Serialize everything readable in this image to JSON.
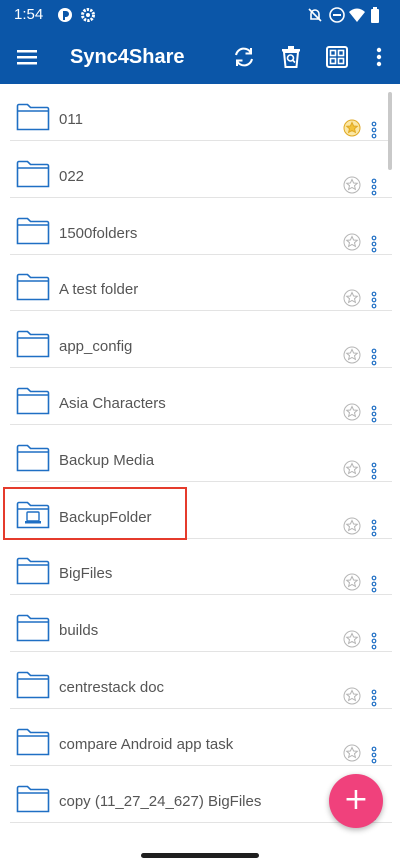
{
  "status_bar": {
    "time": "1:54",
    "left_icons": [
      "app-notification-icon",
      "settings-gear-icon"
    ],
    "right_icons": [
      "notifications-off-icon",
      "do-not-disturb-icon",
      "wifi-icon",
      "battery-icon"
    ]
  },
  "app_bar": {
    "title": "Sync4Share",
    "icons": [
      "menu-icon",
      "sync-icon",
      "recycle-bin-icon",
      "grid-view-icon",
      "overflow-menu-icon"
    ]
  },
  "folders": [
    {
      "name": "011",
      "favorite": true
    },
    {
      "name": "022",
      "favorite": false
    },
    {
      "name": "1500folders",
      "favorite": false
    },
    {
      "name": "A test folder",
      "favorite": false
    },
    {
      "name": "app_config",
      "favorite": false
    },
    {
      "name": "Asia Characters",
      "favorite": false
    },
    {
      "name": "Backup Media",
      "favorite": false
    },
    {
      "name": "BackupFolder",
      "favorite": false,
      "special_icon": "backup-folder-icon"
    },
    {
      "name": "BigFiles",
      "favorite": false
    },
    {
      "name": "builds",
      "favorite": false
    },
    {
      "name": "centrestack doc",
      "favorite": false
    },
    {
      "name": "compare Android app task",
      "favorite": false
    },
    {
      "name": "copy (11_27_24_627) BigFiles",
      "favorite": false
    }
  ],
  "fab": {
    "label": "+"
  },
  "colors": {
    "primary": "#0b56a8",
    "accent": "#f0417c",
    "star_active": "#f2c23a",
    "folder_outline": "#1f6fc4",
    "highlight": "#e53b2c"
  }
}
